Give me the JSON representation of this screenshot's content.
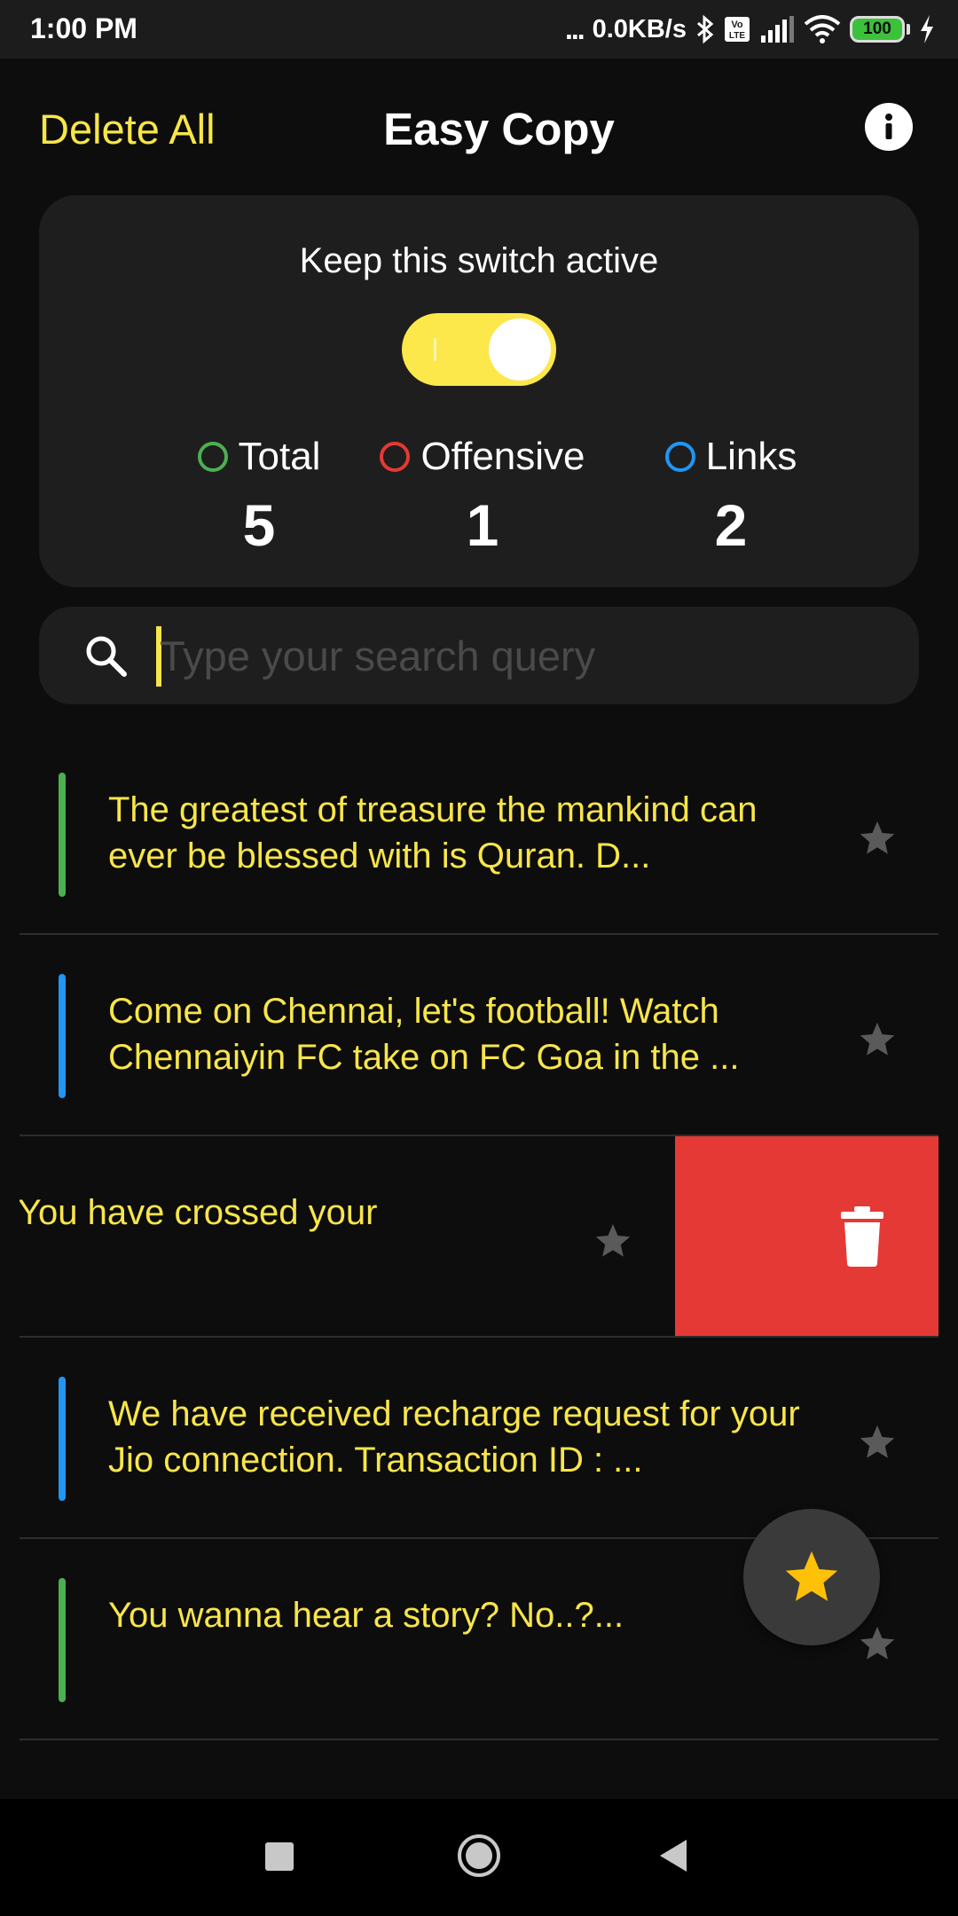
{
  "status_bar": {
    "time": "1:00 PM",
    "dots": "...",
    "speed": "0.0KB/s",
    "battery": "100",
    "icons": [
      "bluetooth-icon",
      "volte-icon",
      "signal-icon",
      "wifi-icon",
      "battery-icon",
      "charging-icon"
    ]
  },
  "header": {
    "delete_all": "Delete All",
    "title": "Easy Copy",
    "info_icon": "info-icon"
  },
  "card": {
    "switch_label": "Keep this switch active",
    "switch_on": true,
    "stats": [
      {
        "label": "Total",
        "value": "5",
        "color": "#4caf50"
      },
      {
        "label": "Offensive",
        "value": "1",
        "color": "#e53935"
      },
      {
        "label": "Links",
        "value": "2",
        "color": "#2196f3"
      }
    ]
  },
  "search": {
    "placeholder": "Type your search query",
    "value": ""
  },
  "items": [
    {
      "text": "The greatest of treasure the mankind can ever be blessed with is Quran. D...",
      "color": "#4caf50"
    },
    {
      "text": "Come on Chennai, let's football! Watch Chennaiyin FC take on FC Goa in the ...",
      "color": "#2196f3"
    },
    {
      "text": "You have crossed your",
      "color": "#4caf50"
    },
    {
      "text": "We have received recharge request for your Jio connection. Transaction ID : ...",
      "color": "#2196f3"
    },
    {
      "text": "You wanna hear a story? No..?...",
      "color": "#4caf50"
    }
  ],
  "colors": {
    "accent": "#f8e54a",
    "delete": "#e53935",
    "fab_star": "#ffc107"
  }
}
